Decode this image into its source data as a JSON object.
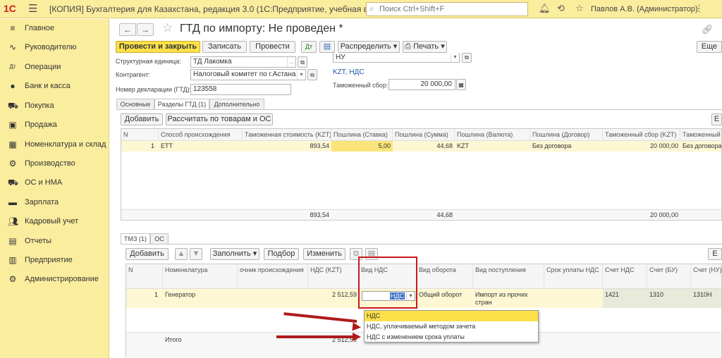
{
  "titlebar": {
    "logo": "1С",
    "title": "[КОПИЯ] Бухгалтерия для Казахстана, редакция 3.0  (1С:Предприятие, учебная версия)",
    "search_placeholder": "Поиск Ctrl+Shift+F",
    "user": "Павлов А.В. (Администратор)"
  },
  "sidebar": {
    "items": [
      {
        "label": "Главное",
        "icon": "menu-icon"
      },
      {
        "label": "Руководителю",
        "icon": "chart-line-icon"
      },
      {
        "label": "Операции",
        "icon": "dt-kt-icon"
      },
      {
        "label": "Банк и касса",
        "icon": "coin-icon"
      },
      {
        "label": "Покупка",
        "icon": "cart-icon"
      },
      {
        "label": "Продажа",
        "icon": "bag-icon"
      },
      {
        "label": "Номенклатура и склад",
        "icon": "grid-icon"
      },
      {
        "label": "Производство",
        "icon": "factory-icon"
      },
      {
        "label": "ОС и НМА",
        "icon": "truck-icon"
      },
      {
        "label": "Зарплата",
        "icon": "money-icon"
      },
      {
        "label": "Кадровый учет",
        "icon": "people-icon"
      },
      {
        "label": "Отчеты",
        "icon": "report-icon"
      },
      {
        "label": "Предприятие",
        "icon": "building-icon"
      },
      {
        "label": "Администрирование",
        "icon": "gear-icon"
      }
    ]
  },
  "document": {
    "title": "ГТД по импорту: Не проведен *",
    "toolbar": {
      "post_close": "Провести и закрыть",
      "save": "Записать",
      "post": "Провести",
      "distribute": "Распределить",
      "print": "Печать",
      "more": "Еще"
    },
    "fields": {
      "unit_label": "Структурная единица:",
      "unit_value": "ТД Лакомка",
      "counterparty_label": "Контрагент:",
      "counterparty_value": "Налоговый комитет по г.Астана",
      "declaration_label": "Номер декларации (ГТД):",
      "declaration_value": "123558",
      "nu_value": "НУ",
      "currency_link": "KZT, НДС",
      "customs_fee_label": "Таможенный сбор:",
      "customs_fee_value": "20 000,00"
    },
    "tabs": [
      "Основные",
      "Разделы ГТД (1)",
      "Дополнительно"
    ],
    "sections": {
      "add": "Добавить",
      "calc": "Рассчитать по товарам и ОС",
      "more_short": "Е",
      "columns": [
        "N",
        "Способ происхождения",
        "Таможенная стоимость (KZT)",
        "Пошлина (Ставка)",
        "Пошлина (Сумма)",
        "Пошлина (Валюта)",
        "Пошлина (Договор)",
        "Таможенный сбор (KZT)",
        "Таможенный"
      ],
      "row": [
        "1",
        "ЕТТ",
        "893,54",
        "5,00",
        "44,68",
        "KZT",
        "Без договора",
        "20 000,00",
        "Без договора"
      ],
      "totals": {
        "cost": "893,54",
        "duty": "44,68",
        "fee": "20 000,00"
      }
    },
    "goods_tabs": [
      "ТМЗ (1)",
      "ОС"
    ],
    "goods": {
      "add": "Добавить",
      "fill": "Заполнить",
      "select": "Подбор",
      "edit": "Изменить",
      "more_short": "Е",
      "columns": [
        "N",
        "Номенклатура",
        "очник происхождения",
        "НДС (KZT)",
        "Вид НДС",
        "Вид оборота",
        "Вид поступления",
        "Срок уплаты НДС",
        "Счет НДС",
        "Счет (БУ)",
        "Счет (НУ)"
      ],
      "row": {
        "n": "1",
        "item": "Генератор",
        "vat": "2 512,59",
        "vat_type": "НДС",
        "turnover": "Общий оборот",
        "receipt": "Импорт из прочих стран",
        "vat_account": "1421",
        "bu_account": "1310",
        "nu_account": "1310Н"
      },
      "total_label": "Итого",
      "total_vat": "2 512,59"
    },
    "dropdown": {
      "options": [
        "НДС",
        "НДС, уплачиваемый методом зачета",
        "НДС с изменением срока уплаты"
      ],
      "selected": 0
    }
  }
}
